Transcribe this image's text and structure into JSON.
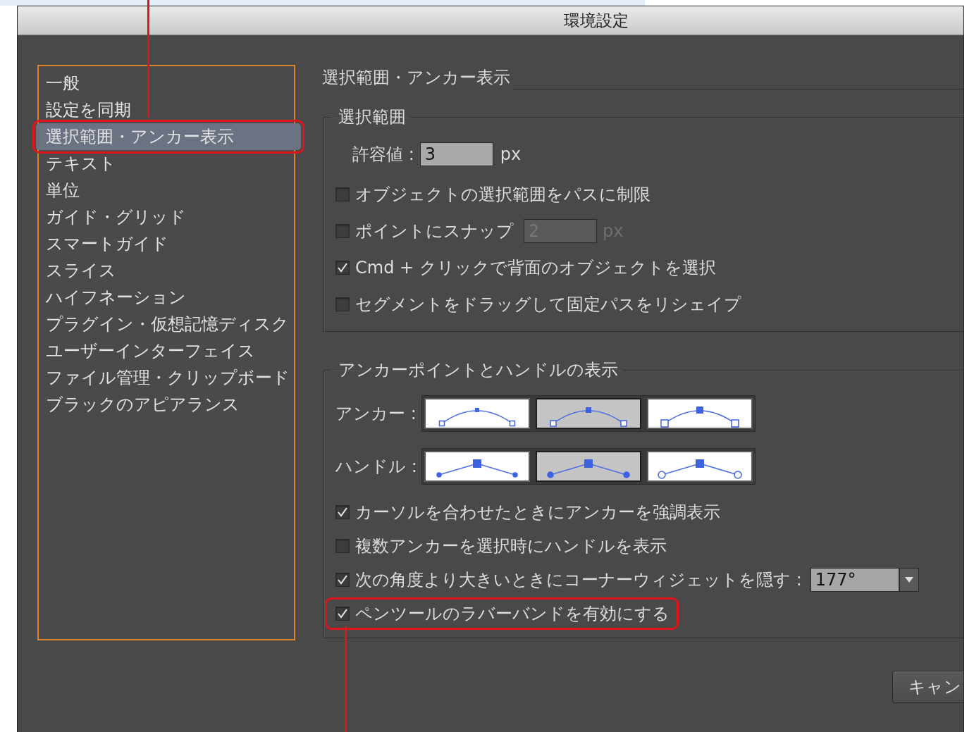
{
  "window": {
    "title": "環境設定"
  },
  "sidebar": {
    "items": [
      {
        "label": "一般",
        "selected": false,
        "highlighted": false
      },
      {
        "label": "設定を同期",
        "selected": false,
        "highlighted": false
      },
      {
        "label": "選択範囲・アンカー表示",
        "selected": true,
        "highlighted": true
      },
      {
        "label": "テキスト",
        "selected": false,
        "highlighted": false
      },
      {
        "label": "単位",
        "selected": false,
        "highlighted": false
      },
      {
        "label": "ガイド・グリッド",
        "selected": false,
        "highlighted": false
      },
      {
        "label": "スマートガイド",
        "selected": false,
        "highlighted": false
      },
      {
        "label": "スライス",
        "selected": false,
        "highlighted": false
      },
      {
        "label": "ハイフネーション",
        "selected": false,
        "highlighted": false
      },
      {
        "label": "プラグイン・仮想記憶ディスク",
        "selected": false,
        "highlighted": false
      },
      {
        "label": "ユーザーインターフェイス",
        "selected": false,
        "highlighted": false
      },
      {
        "label": "ファイル管理・クリップボード",
        "selected": false,
        "highlighted": false
      },
      {
        "label": "ブラックのアピアランス",
        "selected": false,
        "highlighted": false
      }
    ]
  },
  "panel": {
    "heading": "選択範囲・アンカー表示",
    "selection_group": {
      "title": "選択範囲",
      "tolerance": {
        "label": "許容値 :",
        "value": "3",
        "unit": "px"
      },
      "options": [
        {
          "kind": "checkbox",
          "label": "オブジェクトの選択範囲をパスに制限",
          "checked": false,
          "highlighted": false
        },
        {
          "kind": "checkbox_field",
          "label": "ポイントにスナップ",
          "checked": false,
          "highlighted": false,
          "value": "2",
          "unit": "px",
          "disabled": true
        },
        {
          "kind": "checkbox",
          "label": "Cmd + クリックで背面のオブジェクトを選択",
          "checked": true,
          "highlighted": false
        },
        {
          "kind": "checkbox",
          "label": "セグメントをドラッグして固定パスをリシェイプ",
          "checked": false,
          "highlighted": false
        }
      ]
    },
    "display_group": {
      "title": "アンカーポイントとハンドルの表示",
      "anchor": {
        "label": "アンカー :",
        "choices": [
          {
            "kind": "small",
            "selected": false
          },
          {
            "kind": "medium",
            "selected": true
          },
          {
            "kind": "large",
            "selected": false
          }
        ]
      },
      "handle": {
        "label": "ハンドル :",
        "choices": [
          {
            "kind": "small",
            "selected": false
          },
          {
            "kind": "medium",
            "selected": true
          },
          {
            "kind": "large",
            "selected": false
          }
        ]
      },
      "options": [
        {
          "kind": "checkbox",
          "label": "カーソルを合わせたときにアンカーを強調表示",
          "checked": true,
          "highlighted": false
        },
        {
          "kind": "checkbox",
          "label": "複数アンカーを選択時にハンドルを表示",
          "checked": false,
          "highlighted": false
        },
        {
          "kind": "checkbox_dropdown",
          "label": "次の角度より大きいときにコーナーウィジェットを隠す :",
          "checked": true,
          "highlighted": false,
          "value": "177°"
        },
        {
          "kind": "checkbox",
          "label": "ペンツールのラバーバンドを有効にする",
          "checked": true,
          "highlighted": true
        }
      ]
    }
  },
  "buttons": [
    "キャン"
  ]
}
